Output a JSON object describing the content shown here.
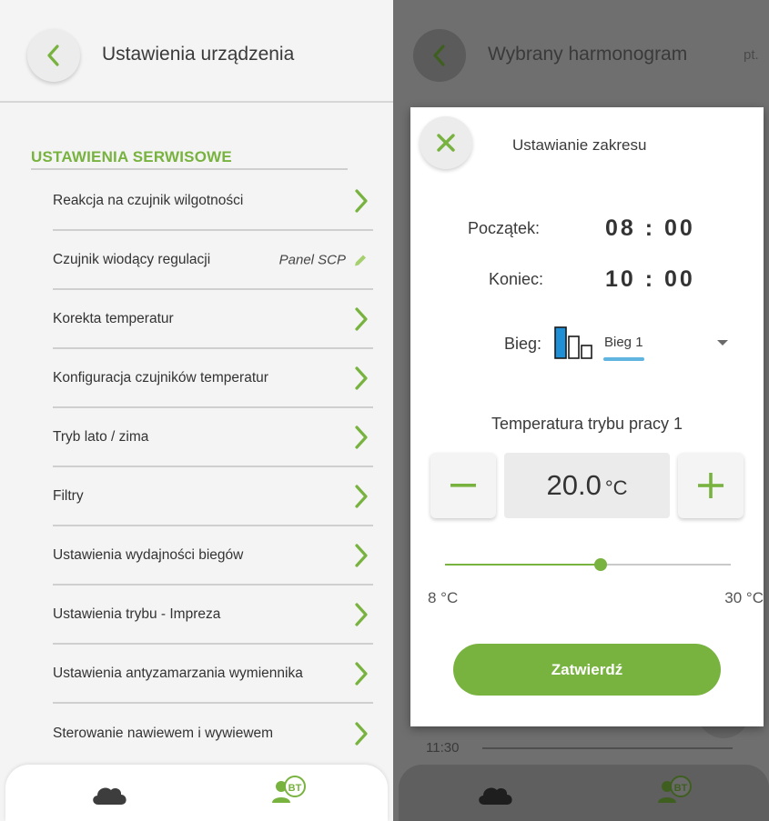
{
  "left": {
    "title": "Ustawienia urządzenia",
    "section_title": "USTAWIENIA SERWISOWE",
    "items": [
      {
        "label": "Reakcja na czujnik wilgotności"
      },
      {
        "label": "Czujnik wiodący regulacji",
        "value": "Panel SCP"
      },
      {
        "label": "Korekta temperatur"
      },
      {
        "label": "Konfiguracja czujników temperatur"
      },
      {
        "label": "Tryb lato / zima"
      },
      {
        "label": "Filtry"
      },
      {
        "label": "Ustawienia wydajności biegów"
      },
      {
        "label": "Ustawienia trybu - Impreza"
      },
      {
        "label": "Ustawienia antyzamarzania wymiennika"
      },
      {
        "label": "Sterowanie nawiewem i wywiewem"
      }
    ],
    "nav": {
      "cloud_icon": "cloud-icon",
      "bt_icon": "bluetooth-user-icon",
      "bt_text": "BT"
    }
  },
  "right": {
    "background_title": "Wybrany harmonogram",
    "background_day": "pt.",
    "background_time": "11:30",
    "dialog": {
      "title": "Ustawianie zakresu",
      "start_label": "Początek:",
      "start_value": "08 : 00",
      "end_label": "Koniec:",
      "end_value": "10 : 00",
      "gear_label": "Bieg:",
      "gear_selected": "Bieg 1",
      "gear_level": 1,
      "gear_levels_total": 3,
      "temp_title": "Temperatura trybu pracy 1",
      "temp_value": "20.0",
      "temp_unit": "°C",
      "min_label": "8 °C",
      "max_label": "30 °C",
      "slider_min": 8,
      "slider_max": 30,
      "slider_value": 20,
      "confirm_label": "Zatwierdź"
    }
  },
  "colors": {
    "accent": "#78b23f",
    "overlay": "#6f6f6f",
    "gear_active": "#1f8fd6",
    "underline": "#5fb4e0"
  }
}
